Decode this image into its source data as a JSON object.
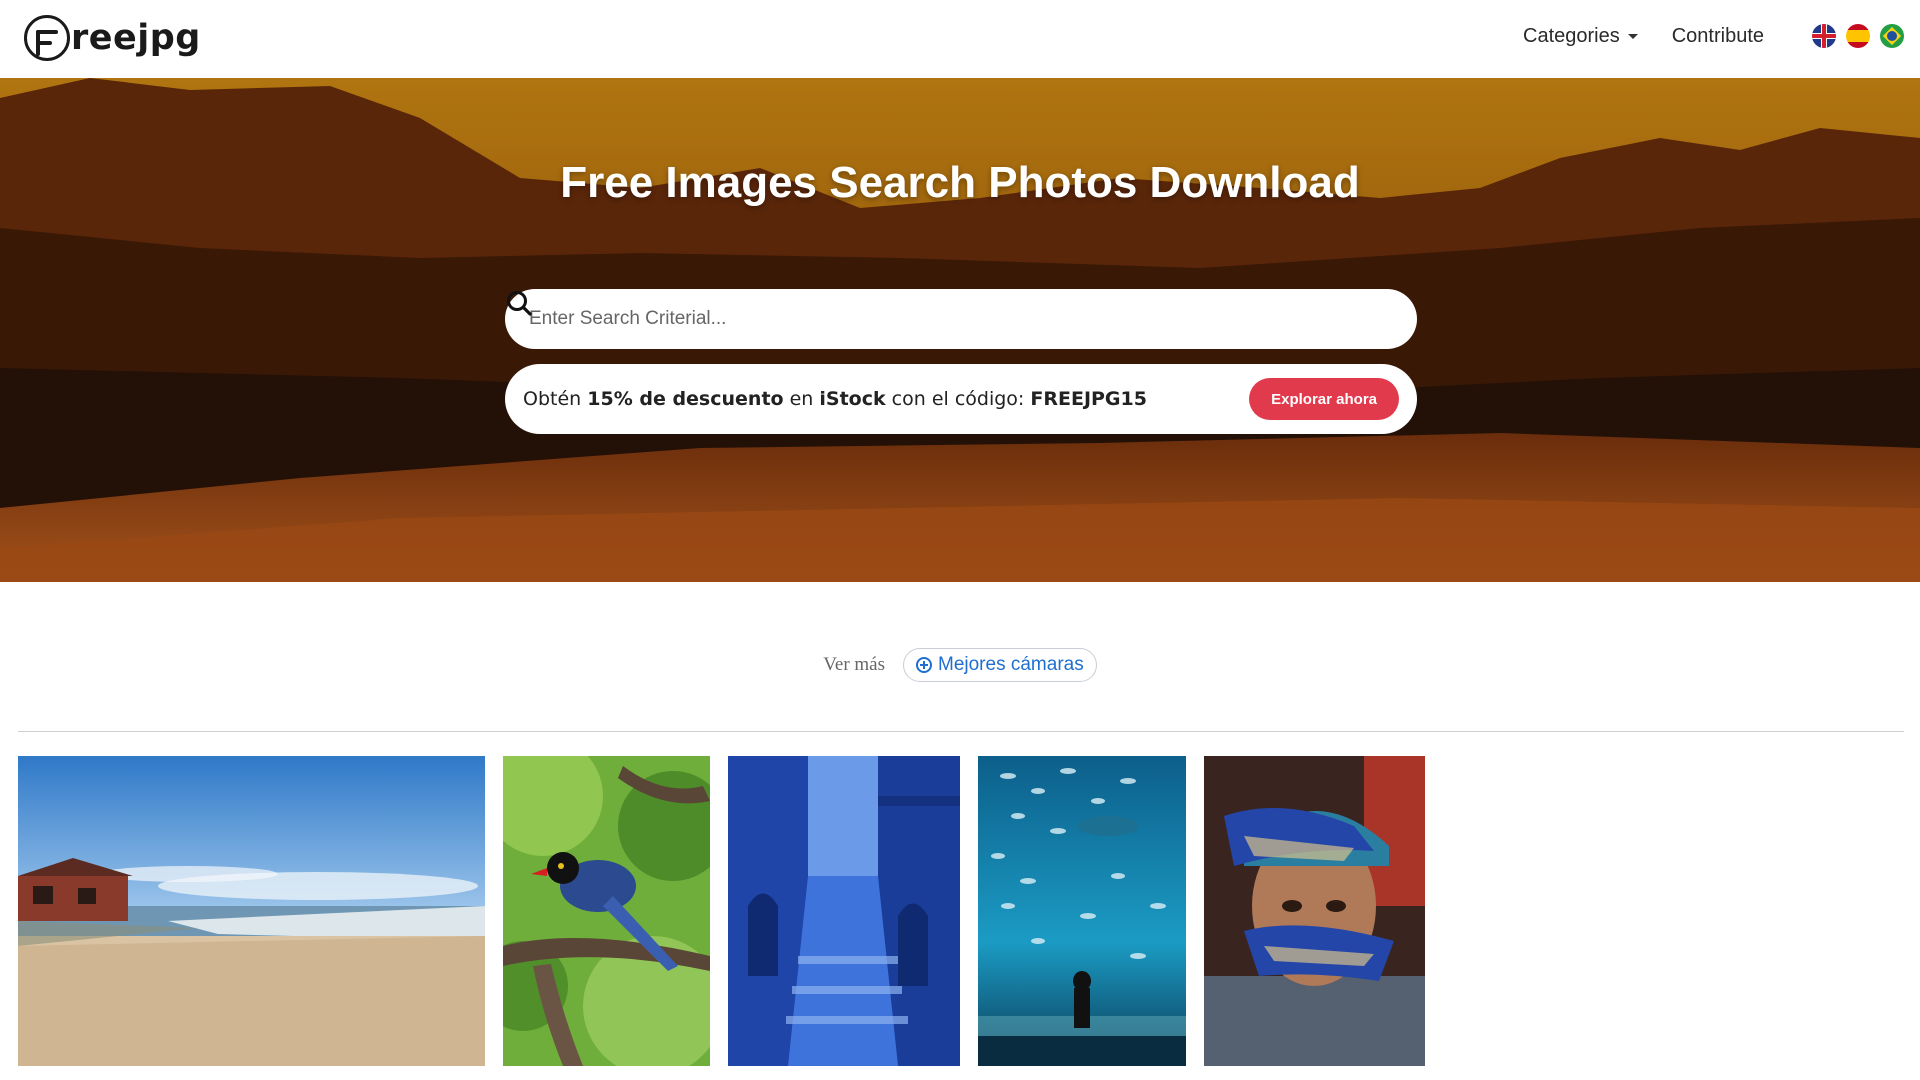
{
  "header": {
    "logo_text": "reejpg",
    "nav": {
      "categories_label": "Categories",
      "contribute_label": "Contribute"
    },
    "flags": [
      "english-flag-icon",
      "spanish-flag-icon",
      "brazil-flag-icon"
    ]
  },
  "hero": {
    "title": "Free Images Search Photos Download",
    "search": {
      "placeholder": "Enter Search Criterial...",
      "value": ""
    },
    "promo": {
      "text_before": "Obtén ",
      "discount": "15% de descuento",
      "text_middle": " en ",
      "brand": "iStock",
      "text_after": " con el código: ",
      "code": "FREEJPG15",
      "button_label": "Explorar ahora"
    }
  },
  "ver_mas": {
    "label": "Ver más",
    "chip_label": "Mejores cámaras"
  },
  "colors": {
    "promo_button": "#e23a4d",
    "chip_text": "#1f6fd1"
  },
  "gallery": [
    "beach-photo",
    "blue-bird-photo",
    "blue-alley-photo",
    "aquarium-photo",
    "painted-hands-photo"
  ]
}
